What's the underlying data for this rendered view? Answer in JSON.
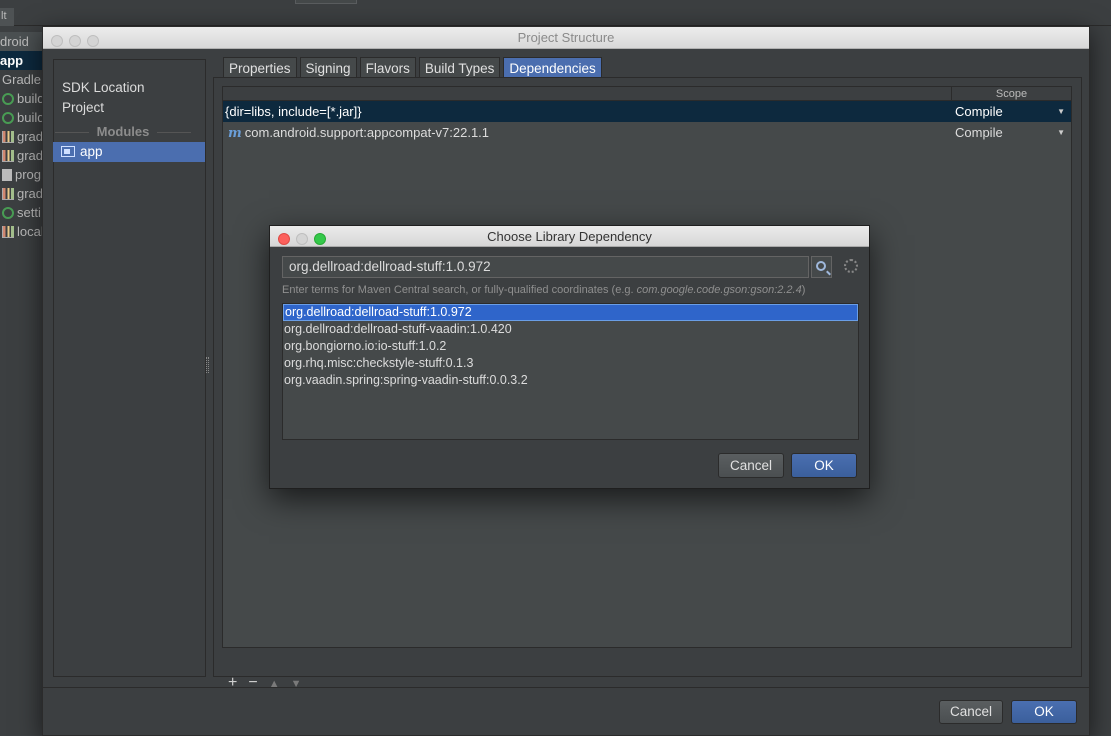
{
  "ide": {
    "top_tab": "lt",
    "side_rows": [
      "droid",
      "app",
      "Gradle S",
      "build",
      "build",
      "grad",
      "grad",
      "prog",
      "grad",
      "setti",
      "local"
    ]
  },
  "main_window": {
    "title": "Project Structure",
    "sidebar": {
      "add": "+",
      "remove": "−",
      "sdk_location": "SDK Location",
      "project": "Project",
      "modules_header": "Modules",
      "module_app": "app"
    },
    "tabs": [
      "Properties",
      "Signing",
      "Flavors",
      "Build Types",
      "Dependencies"
    ],
    "active_tab": "Dependencies",
    "table": {
      "scope_header": "Scope",
      "rows": [
        {
          "name": "{dir=libs, include=[*.jar]}",
          "scope": "Compile",
          "icon": ""
        },
        {
          "name": "com.android.support:appcompat-v7:22.1.1",
          "scope": "Compile",
          "icon": "m"
        }
      ],
      "tools": {
        "add": "+",
        "remove": "−",
        "up": "▲",
        "down": "▼"
      }
    },
    "cancel": "Cancel",
    "ok": "OK"
  },
  "dialog": {
    "title": "Choose Library Dependency",
    "search_value": "org.dellroad:dellroad-stuff:1.0.972",
    "hint_prefix": "Enter terms for Maven Central search, or fully-qualified coordinates (e.g. ",
    "hint_example": "com.google.code.gson:gson:2.2.4",
    "hint_suffix": ")",
    "results": [
      "org.dellroad:dellroad-stuff:1.0.972",
      "org.dellroad:dellroad-stuff-vaadin:1.0.420",
      "org.bongiorno.io:io-stuff:1.0.2",
      "org.rhq.misc:checkstyle-stuff:0.1.3",
      "org.vaadin.spring:spring-vaadin-stuff:0.0.3.2"
    ],
    "cancel": "Cancel",
    "ok": "OK"
  },
  "colors": {
    "selection": "#2f65ca",
    "primary_button": "#4a6fb0",
    "dark_selection": "#0d293e",
    "close_red": "#fc605c",
    "zoom_green": "#34c84a"
  }
}
